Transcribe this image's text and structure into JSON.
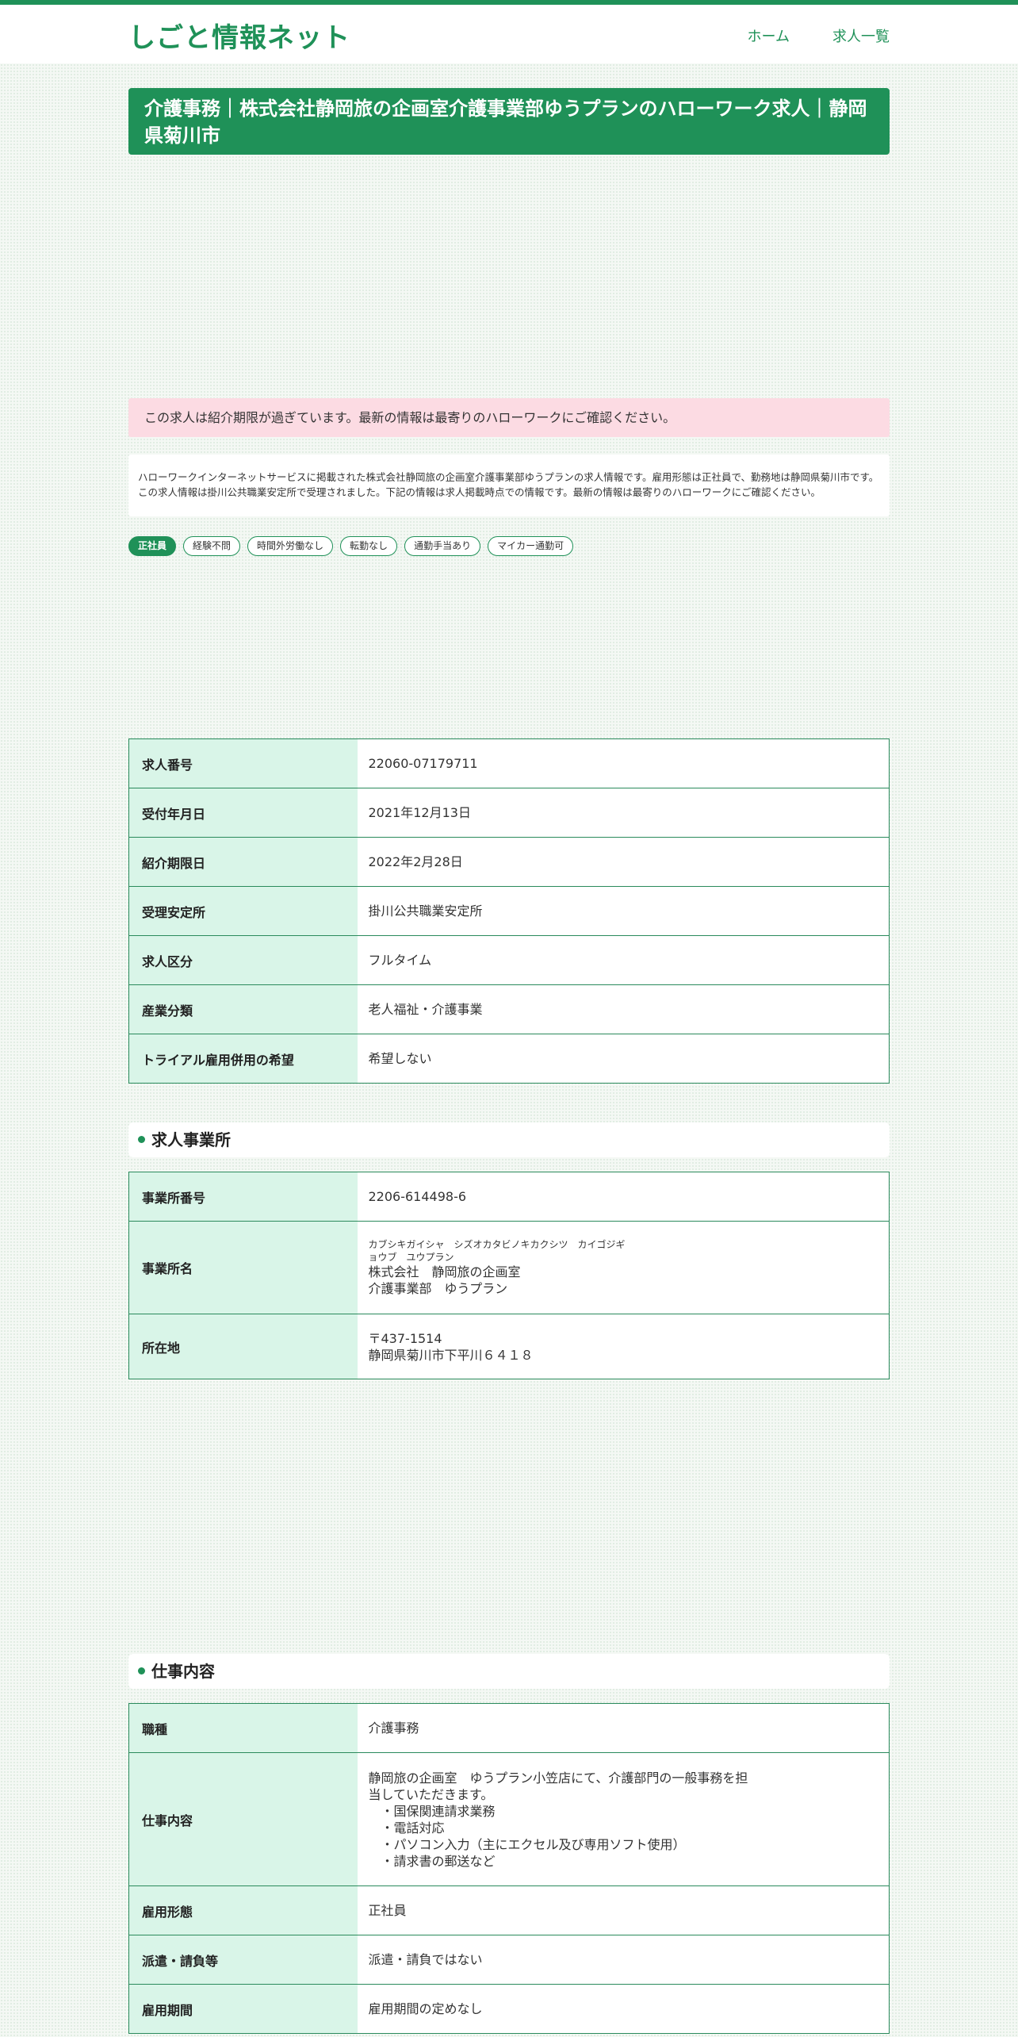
{
  "site": {
    "logo": "しごと情報ネット"
  },
  "nav": {
    "home": "ホーム",
    "jobs": "求人一覧"
  },
  "page_title": "介護事務｜株式会社静岡旅の企画室介護事業部ゆうプランのハローワーク求人｜静岡県菊川市",
  "alert": "この求人は紹介期限が過ぎています。最新の情報は最寄りのハローワークにご確認ください。",
  "description": "ハローワークインターネットサービスに掲載された株式会社静岡旅の企画室介護事業部ゆうプランの求人情報です。雇用形態は正社員で、勤務地は静岡県菊川市です。この求人情報は掛川公共職業安定所で受理されました。下記の情報は求人掲載時点での情報です。最新の情報は最寄りのハローワークにご確認ください。",
  "tags": [
    "正社員",
    "経験不問",
    "時間外労働なし",
    "転勤なし",
    "通勤手当あり",
    "マイカー通勤可"
  ],
  "basic_info": [
    {
      "label": "求人番号",
      "value": "22060-07179711"
    },
    {
      "label": "受付年月日",
      "value": "2021年12月13日"
    },
    {
      "label": "紹介期限日",
      "value": "2022年2月28日"
    },
    {
      "label": "受理安定所",
      "value": "掛川公共職業安定所"
    },
    {
      "label": "求人区分",
      "value": "フルタイム"
    },
    {
      "label": "産業分類",
      "value": "老人福祉・介護事業"
    },
    {
      "label": "トライアル雇用併用の希望",
      "value": "希望しない"
    }
  ],
  "office_section": {
    "title": "求人事業所",
    "number_label": "事業所番号",
    "number": "2206-614498-6",
    "name_label": "事業所名",
    "name_kana_1": "カブシキガイシャ　シズオカタビノキカクシツ　カイゴジギ",
    "name_kana_2": "ョウブ　ユウプラン",
    "name_1": "株式会社　静岡旅の企画室",
    "name_2": "介護事業部　ゆうプラン",
    "address_label": "所在地",
    "postal": "〒437-1514",
    "address": "静岡県菊川市下平川６４１８"
  },
  "job_section": {
    "title": "仕事内容",
    "occupation_label": "職種",
    "occupation": "介護事務",
    "content_label": "仕事内容",
    "content_lines": [
      "静岡旅の企画室　ゆうプラン小笠店にて、介護部門の一般事務を担",
      "当していただきます。",
      "　・国保関連請求業務",
      "　・電話対応",
      "　・パソコン入力（主にエクセル及び専用ソフト使用）",
      "　・請求書の郵送など"
    ],
    "employment_label": "雇用形態",
    "employment": "正社員",
    "dispatch_label": "派遣・請負等",
    "dispatch": "派遣・請負ではない",
    "period_label": "雇用期間",
    "period": "雇用期間の定めなし"
  }
}
